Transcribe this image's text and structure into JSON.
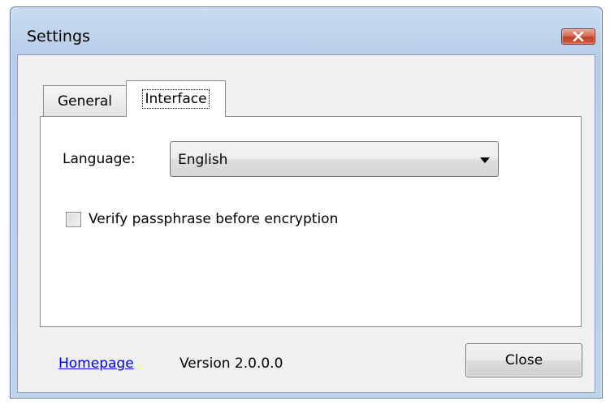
{
  "window": {
    "title": "Settings",
    "close_icon": "close-icon"
  },
  "tabs": [
    {
      "label": "General",
      "selected": false
    },
    {
      "label": "Interface",
      "selected": true
    }
  ],
  "interface_panel": {
    "language_label": "Language:",
    "language_value": "English",
    "dropdown_icon": "chevron-down-icon",
    "verify_label": "Verify passphrase before encryption",
    "verify_checked": false
  },
  "footer": {
    "homepage_link": "Homepage",
    "version_text": "Version 2.0.0.0",
    "close_button": "Close"
  },
  "colors": {
    "titlebar": "#b9cfe9",
    "close_button_red": "#c7462e",
    "link": "#0000ff",
    "panel_background": "#ffffff",
    "dialog_background": "#f0f0f0"
  }
}
